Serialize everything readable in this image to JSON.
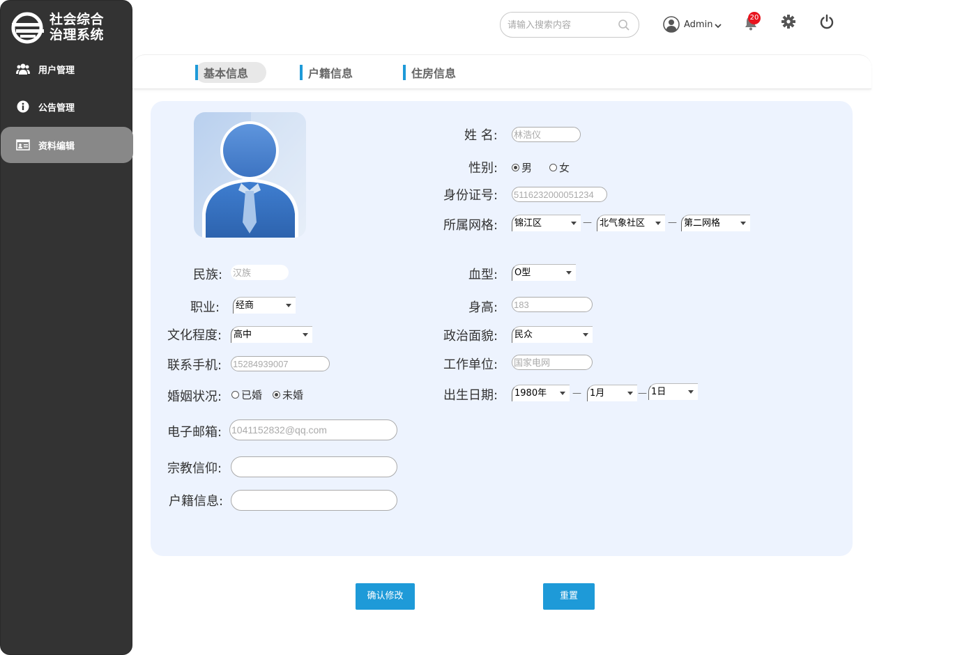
{
  "app": {
    "title_line1": "社会综合",
    "title_line2": "治理系统"
  },
  "sidebar": {
    "items": [
      {
        "label": "用户管理",
        "icon": "users-icon"
      },
      {
        "label": "公告管理",
        "icon": "info-icon"
      },
      {
        "label": "资料编辑",
        "icon": "id-card-icon",
        "active": true
      }
    ]
  },
  "header": {
    "search_placeholder": "请输入搜索内容",
    "username": "Admin",
    "notification_count": "20"
  },
  "tabs": [
    {
      "label": "基本信息",
      "active": true
    },
    {
      "label": "户籍信息"
    },
    {
      "label": "住房信息"
    }
  ],
  "form": {
    "name_label": "姓 名:",
    "name_value": "林浩仪",
    "gender_label": "性别:",
    "gender_male": "男",
    "gender_female": "女",
    "gender_selected": "男",
    "id_label": "身份证号:",
    "id_value": "5116232000051234",
    "grid_label": "所属网格:",
    "grid_district": "锦江区",
    "grid_community": "北气象社区",
    "grid_cell": "第二网格",
    "ethnicity_label": "民族:",
    "ethnicity_value": "汉族",
    "blood_label": "血型:",
    "blood_value": "O型",
    "job_label": "职业:",
    "job_value": "经商",
    "height_label": "身高:",
    "height_value": "183",
    "education_label": "文化程度:",
    "education_value": "高中",
    "political_label": "政治面貌:",
    "political_value": "民众",
    "phone_label": "联系手机:",
    "phone_value": "15284939007",
    "workplace_label": "工作单位:",
    "workplace_value": "国家电网",
    "marital_label": "婚姻状况:",
    "marital_married": "已婚",
    "marital_single": "未婚",
    "marital_selected": "未婚",
    "birth_label": "出生日期:",
    "birth_year": "1980年",
    "birth_month": "1月",
    "birth_day": "1日",
    "email_label": "电子邮箱:",
    "email_value": "1041152832@qq.com",
    "religion_label": "宗教信仰:",
    "religion_value": "",
    "household_label": "户籍信息:",
    "household_value": ""
  },
  "actions": {
    "confirm_label": "确认修改",
    "reset_label": "重置"
  },
  "colors": {
    "accent": "#1e9ad8",
    "sidebar": "#333333",
    "panel": "#edf3fe",
    "badge": "#e8141e"
  }
}
